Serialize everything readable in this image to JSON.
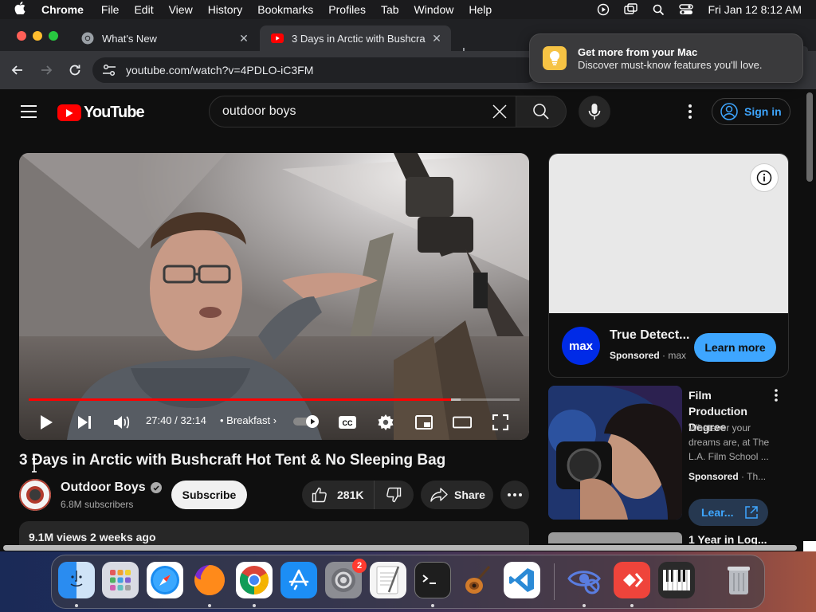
{
  "menubar": {
    "app_name": "Chrome",
    "items": [
      "File",
      "Edit",
      "View",
      "History",
      "Bookmarks",
      "Profiles",
      "Tab",
      "Window",
      "Help"
    ],
    "datetime": "Fri Jan 12  8:12 AM"
  },
  "tabs": [
    {
      "title": "What's New",
      "icon": "chrome-icon"
    },
    {
      "title": "3 Days in Arctic with Bushcra",
      "icon": "youtube-icon"
    }
  ],
  "toolbar": {
    "url": "youtube.com/watch?v=4PDLO-iC3FM"
  },
  "notification": {
    "title": "Get more from your Mac",
    "body": "Discover must-know features you'll love.",
    "icon": "lightbulb-icon"
  },
  "youtube": {
    "logo_text": "YouTube",
    "search_value": "outdoor boys",
    "signin_label": "Sign in"
  },
  "player": {
    "time": "27:40 / 32:14",
    "chapter": "Breakfast",
    "progress_fraction": 0.86,
    "buffered_fraction": 0.88
  },
  "video": {
    "title": "3 Days in Arctic with Bushcraft Hot Tent & No Sleeping Bag",
    "channel": "Outdoor Boys",
    "subscribers": "6.8M subscribers",
    "subscribe_label": "Subscribe",
    "likes": "281K",
    "share_label": "Share",
    "views_date": "9.1M views  2 weeks ago"
  },
  "ad": {
    "brand_logo": "max",
    "title": "True Detect...",
    "sponsored": "Sponsored",
    "advertiser": "max",
    "cta": "Learn more"
  },
  "side_ad": {
    "title": "Film Production Degree",
    "description": "Whatever your dreams are, at The L.A. Film School ...",
    "sponsored": "Sponsored",
    "advertiser": "Th...",
    "cta": "Lear..."
  },
  "next_video": {
    "title": "1 Year in Log..."
  },
  "dock": {
    "apps": [
      "finder",
      "launchpad",
      "safari",
      "firefox",
      "chrome",
      "app-store",
      "system-settings",
      "textedit",
      "terminal",
      "garageband",
      "vscode",
      "privacy-app",
      "anydesk",
      "piano-app",
      "trash"
    ],
    "settings_badge": "2"
  },
  "colors": {
    "youtube_red": "#ff0000",
    "link_blue": "#3ea6ff",
    "max_blue": "#002be7"
  }
}
